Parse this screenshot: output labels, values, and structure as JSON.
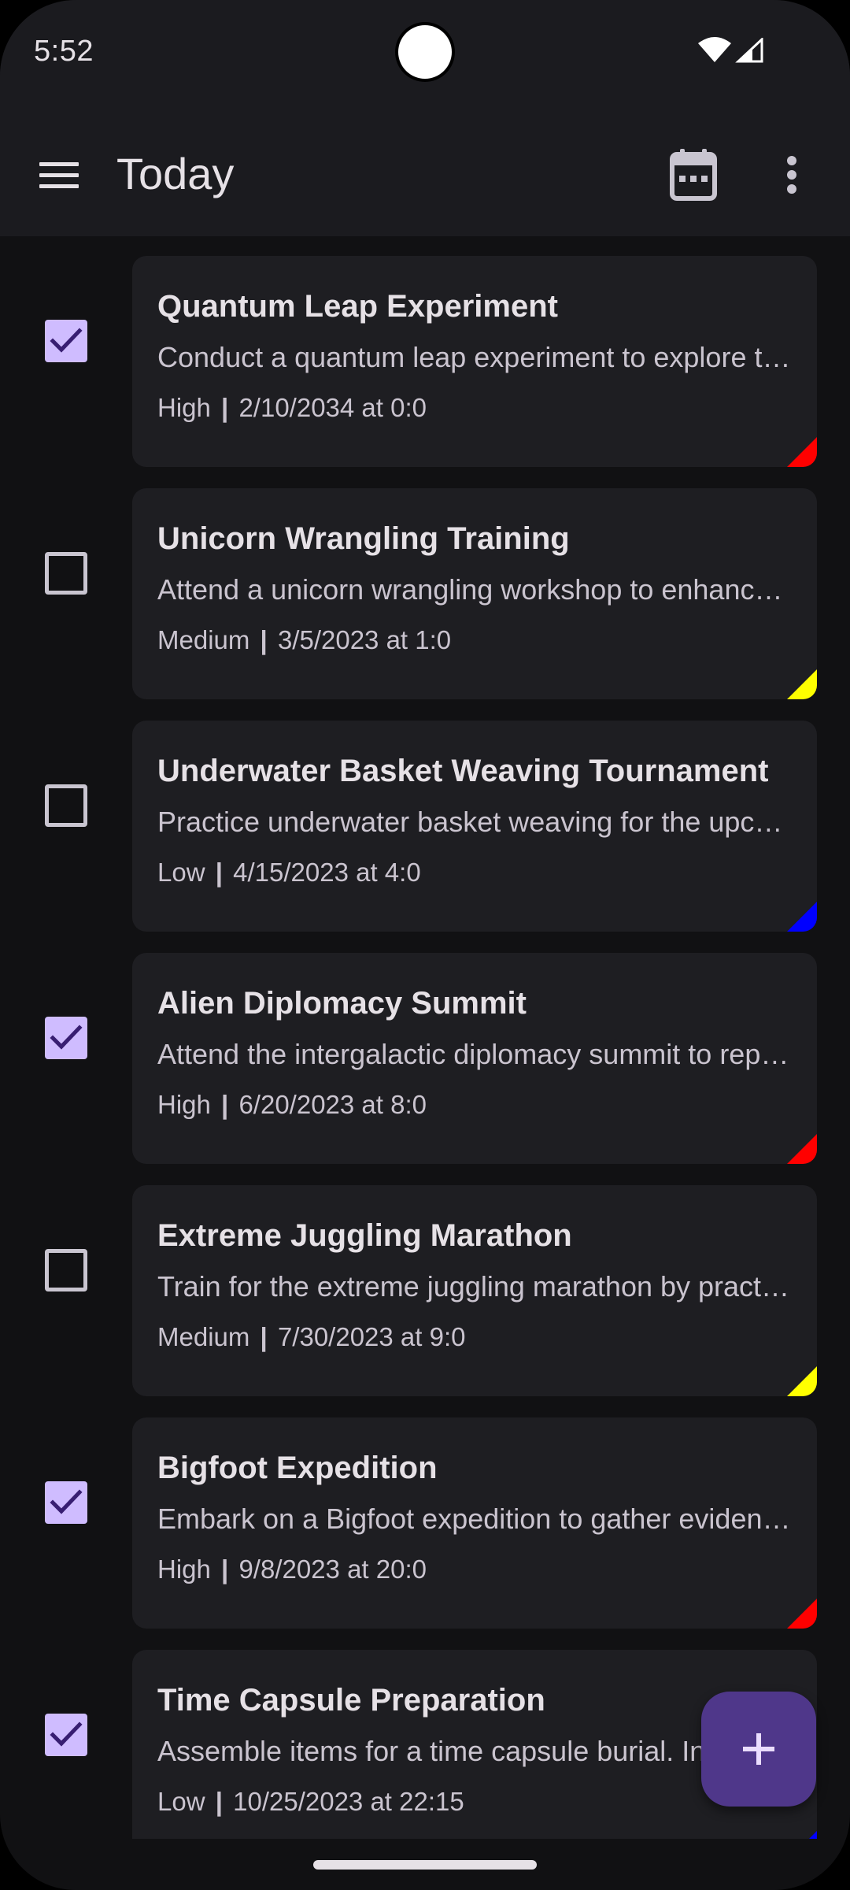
{
  "status_bar": {
    "time": "5:52"
  },
  "app_bar": {
    "title": "Today"
  },
  "icons": {
    "menu": "menu-icon",
    "calendar": "calendar-icon",
    "more": "more-vert-icon",
    "add": "add-icon",
    "check": "check-icon"
  },
  "colors": {
    "accent": "#cfbcff",
    "fab": "#4f378a",
    "priority_high": "#ff0000",
    "priority_medium": "#ffff00",
    "priority_low": "#0000ff"
  },
  "tasks": [
    {
      "title": "Quantum Leap Experiment",
      "description": "Conduct a quantum leap experiment to explore the possibilities of time travel",
      "priority": "High",
      "datetime": "2/10/2034 at 0:0",
      "done": true,
      "color": "#ff0000"
    },
    {
      "title": "Unicorn Wrangling Training",
      "description": "Attend a unicorn wrangling workshop to enhance your skills",
      "priority": "Medium",
      "datetime": "3/5/2023 at 1:0",
      "done": false,
      "color": "#ffff00"
    },
    {
      "title": "Underwater Basket Weaving Tournament",
      "description": "Practice underwater basket weaving for the upcoming tournament",
      "priority": "Low",
      "datetime": "4/15/2023 at 4:0",
      "done": false,
      "color": "#0000ff"
    },
    {
      "title": "Alien Diplomacy Summit",
      "description": "Attend the intergalactic diplomacy summit to represent Earth",
      "priority": "High",
      "datetime": "6/20/2023 at 8:0",
      "done": true,
      "color": "#ff0000"
    },
    {
      "title": "Extreme Juggling Marathon",
      "description": "Train for the extreme juggling marathon by practicing daily",
      "priority": "Medium",
      "datetime": "7/30/2023 at 9:0",
      "done": false,
      "color": "#ffff00"
    },
    {
      "title": "Bigfoot Expedition",
      "description": "Embark on a Bigfoot expedition to gather evidence of its existence",
      "priority": "High",
      "datetime": "9/8/2023 at 20:0",
      "done": true,
      "color": "#ff0000"
    },
    {
      "title": "Time Capsule Preparation",
      "description": "Assemble items for a time capsule burial. Include letters and photos",
      "priority": "Low",
      "datetime": "10/25/2023 at 22:15",
      "done": true,
      "color": "#0000ff"
    }
  ]
}
